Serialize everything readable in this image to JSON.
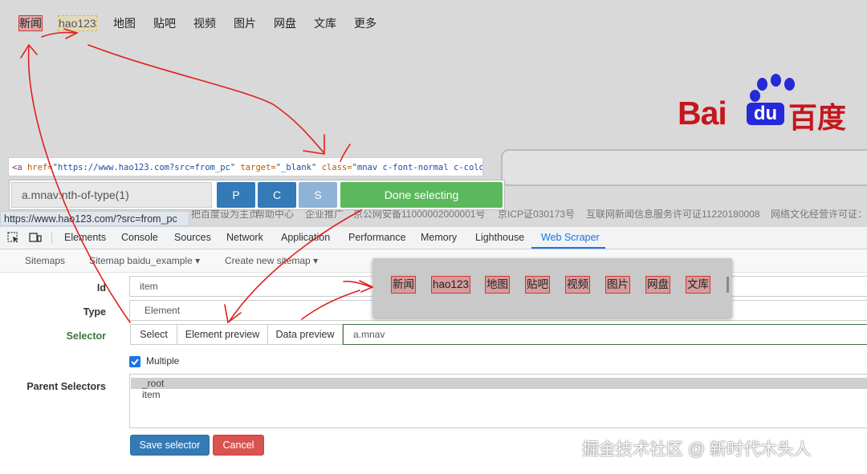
{
  "nav": {
    "items": [
      "新闻",
      "hao123",
      "地图",
      "贴吧",
      "视频",
      "图片",
      "网盘",
      "文库",
      "更多"
    ]
  },
  "logo": {
    "bai": "Bai",
    "du": "du",
    "baidu_cn": "百度"
  },
  "element_code": {
    "tag_open": "<a ",
    "href_attr": "href=",
    "href_val": "\"https://www.hao123.com?src=from_pc\"",
    "target_attr": " target=",
    "target_val": "\"_blank\"",
    "class_attr": " class=",
    "class_val": "\"mnav c-font-normal c-color-t\"",
    "tag_close": ">"
  },
  "selector_bar": {
    "value": "a.mnav:nth-of-type(1)",
    "p_label": "P",
    "c_label": "C",
    "s_label": "S",
    "done_label": "Done selecting"
  },
  "footer": {
    "items": [
      "把百度设为主页",
      "帮助中心",
      "企业推广",
      "京公网安备11000002000001号",
      "京ICP证030173号",
      "互联网新闻信息服务许可证11220180008",
      "网络文化经营许可证："
    ]
  },
  "status_url": "https://www.hao123.com/?src=from_pc",
  "devtools": {
    "tabs": [
      "Elements",
      "Console",
      "Sources",
      "Network",
      "Application",
      "Performance",
      "Memory",
      "Lighthouse",
      "Web Scraper"
    ],
    "active_tab": "Web Scraper"
  },
  "scraper_nav": {
    "sitemaps": "Sitemaps",
    "sitemap": "Sitemap baidu_example",
    "create": "Create new sitemap"
  },
  "form": {
    "id_label": "Id",
    "id_value": "item",
    "type_label": "Type",
    "type_value": "Element",
    "selector_label": "Selector",
    "select_btn": "Select",
    "element_preview_btn": "Element preview",
    "data_preview_btn": "Data preview",
    "selector_value": "a.mnav",
    "multiple_label": "Multiple",
    "multiple_checked": true,
    "parent_label": "Parent Selectors",
    "parent_items": [
      "_root",
      "item"
    ],
    "save_label": "Save selector",
    "cancel_label": "Cancel"
  },
  "preview": {
    "items": [
      "新闻",
      "hao123",
      "地图",
      "贴吧",
      "视频",
      "图片",
      "网盘",
      "文库"
    ]
  },
  "watermark": "掘金技术社区 @ 新时代木头人",
  "colors": {
    "accent": "#1a73e8",
    "done_green": "#5cb85c",
    "save_blue": "#337ab7",
    "cancel_red": "#d9534f",
    "baidu_red": "#c5161d",
    "baidu_blue": "#2529d8",
    "highlight_red": "#dd3333"
  }
}
